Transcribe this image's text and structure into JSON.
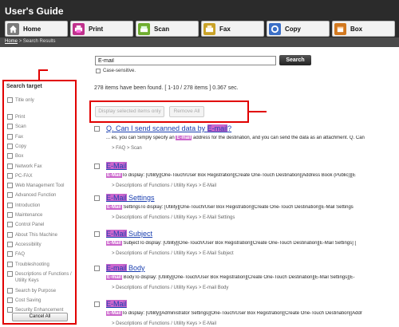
{
  "app": {
    "title": "User's Guide"
  },
  "nav": [
    {
      "label": "Home",
      "icon": "home-icon",
      "color": "#7a7a7a"
    },
    {
      "label": "Print",
      "icon": "print-icon",
      "color": "#c0308c"
    },
    {
      "label": "Scan",
      "icon": "scan-icon",
      "color": "#6fae2f"
    },
    {
      "label": "Fax",
      "icon": "fax-icon",
      "color": "#c9a227"
    },
    {
      "label": "Copy",
      "icon": "copy-icon",
      "color": "#3b6fc7"
    },
    {
      "label": "Box",
      "icon": "box-icon",
      "color": "#d2781e"
    }
  ],
  "breadcrumb": {
    "home": "Home",
    "sep": ">",
    "current": "Search Results"
  },
  "sidebar": {
    "title": "Search target",
    "title_only": "Title only",
    "items": [
      "Print",
      "Scan",
      "Fax",
      "Copy",
      "Box",
      "Network Fax",
      "PC-FAX",
      "Web Management Tool",
      "Advanced Function",
      "Introduction",
      "Maintenance",
      "Control Panel",
      "About This Machine",
      "Accessibility",
      "FAQ",
      "Troubleshooting",
      "Descriptions of Functions / Utility Keys",
      "Search by Purpose",
      "Cost Saving",
      "Security Enhancement"
    ],
    "cancel_all": "Cancel All"
  },
  "search": {
    "query": "E-mail",
    "button": "Search",
    "case_sensitive": "Case-sensitive."
  },
  "results_summary": "278 items have been found. [ 1-10 / 278 items ] 0.367 sec.",
  "actions": {
    "display_selected": "Display selected items only",
    "remove_all": "Remove All"
  },
  "results": [
    {
      "title_pre": "Q. Can I send scanned data by ",
      "title_hl": "E-mail",
      "title_post": "?",
      "snip_pre": "... es, you can Simply specify an ",
      "snip_hl": "E-mail",
      "snip_post": " address for the destination, and you can send the data as an attachment. Q. Can",
      "path": "> FAQ > Scan"
    },
    {
      "title_pre": "",
      "title_hl": "E-Mail",
      "title_post": "",
      "snip_pre": "",
      "snip_hl": "E-Mail",
      "snip_post": "To display: [Utility][One-Touch/User Box Registration][Create One-Touch Destination][Address Book (Public)][E",
      "path": "> Descriptions of Functions / Utility Keys > E-Mail"
    },
    {
      "title_pre": "",
      "title_hl": "E-Mail",
      "title_post": " Settings",
      "snip_pre": "",
      "snip_hl": "E-Mail",
      "snip_post": " SettingsTo display: [Utility][One-Touch/User Box Registration][Create One-Touch Destination][E-Mail Settings",
      "path": "> Descriptions of Functions / Utility Keys > E-Mail Settings"
    },
    {
      "title_pre": "",
      "title_hl": "E-Mail",
      "title_post": " Subject",
      "snip_pre": "",
      "snip_hl": "E-Mail",
      "snip_post": " SubjectTo display: [Utility][One-Touch/User Box Registration][Create One-Touch Destination][E-Mail Settings] [",
      "path": "> Descriptions of Functions / Utility Keys > E-Mail Subject"
    },
    {
      "title_pre": "",
      "title_hl": "E-mail",
      "title_post": " Body",
      "snip_pre": "",
      "snip_hl": "E-mail",
      "snip_post": " BodyTo display: [Utility][One-Touch/User Box Registration][Create One-Touch Destination][E-Mail Settings][E-",
      "path": "> Descriptions of Functions / Utility Keys > E-mail Body"
    },
    {
      "title_pre": "",
      "title_hl": "E-Mail",
      "title_post": "",
      "snip_pre": "",
      "snip_hl": "E-Mail",
      "snip_post": "To display: [Utility][Administrator Settings][One-Touch/User Box Registration][Create One-Touch Destination][Addr",
      "path": "> Descriptions of Functions / Utility Keys > E-Mail"
    }
  ]
}
